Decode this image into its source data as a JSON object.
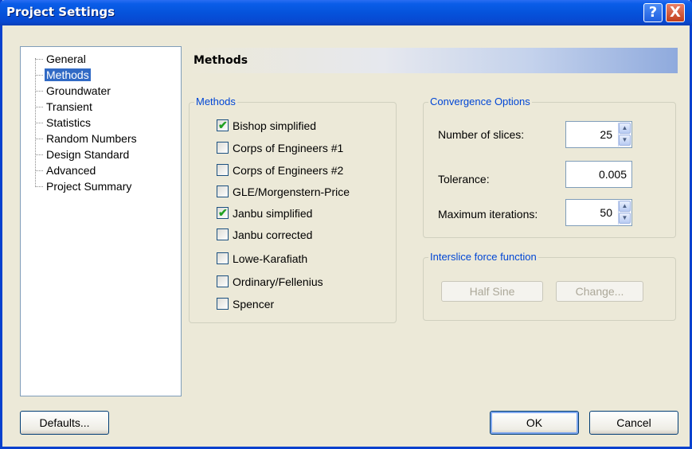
{
  "window": {
    "title": "Project Settings",
    "help_label": "?",
    "close_label": "X"
  },
  "tree": {
    "items": [
      {
        "label": "General"
      },
      {
        "label": "Methods",
        "selected": true
      },
      {
        "label": "Groundwater"
      },
      {
        "label": "Transient"
      },
      {
        "label": "Statistics"
      },
      {
        "label": "Random Numbers"
      },
      {
        "label": "Design Standard"
      },
      {
        "label": "Advanced"
      },
      {
        "label": "Project Summary"
      }
    ]
  },
  "page": {
    "heading": "Methods"
  },
  "methods_group": {
    "label": "Methods",
    "options": [
      {
        "label": "Bishop simplified",
        "checked": true
      },
      {
        "label": "Corps of Engineers #1",
        "checked": false
      },
      {
        "label": "Corps of Engineers #2",
        "checked": false
      },
      {
        "label": "GLE/Morgenstern-Price",
        "checked": false
      },
      {
        "label": "Janbu simplified",
        "checked": true
      },
      {
        "label": "Janbu corrected",
        "checked": false
      },
      {
        "label": "Lowe-Karafiath",
        "checked": false
      },
      {
        "label": "Ordinary/Fellenius",
        "checked": false
      },
      {
        "label": "Spencer",
        "checked": false
      }
    ]
  },
  "convergence": {
    "label": "Convergence Options",
    "slices_label": "Number of slices:",
    "slices_value": "25",
    "tolerance_label": "Tolerance:",
    "tolerance_value": "0.005",
    "iterations_label": "Maximum iterations:",
    "iterations_value": "50"
  },
  "interslice": {
    "label": "Interslice force function",
    "function_value": "Half Sine",
    "change_label": "Change..."
  },
  "buttons": {
    "defaults": "Defaults...",
    "ok": "OK",
    "cancel": "Cancel"
  },
  "colors": {
    "titlebar": "#0553DB",
    "selection": "#316AC5",
    "group_label": "#0046D5",
    "check": "#21A121"
  },
  "icons": {
    "help": "help-icon",
    "close": "close-icon",
    "check": "checkmark-icon",
    "spin_up": "spin-up-icon",
    "spin_down": "spin-down-icon"
  }
}
